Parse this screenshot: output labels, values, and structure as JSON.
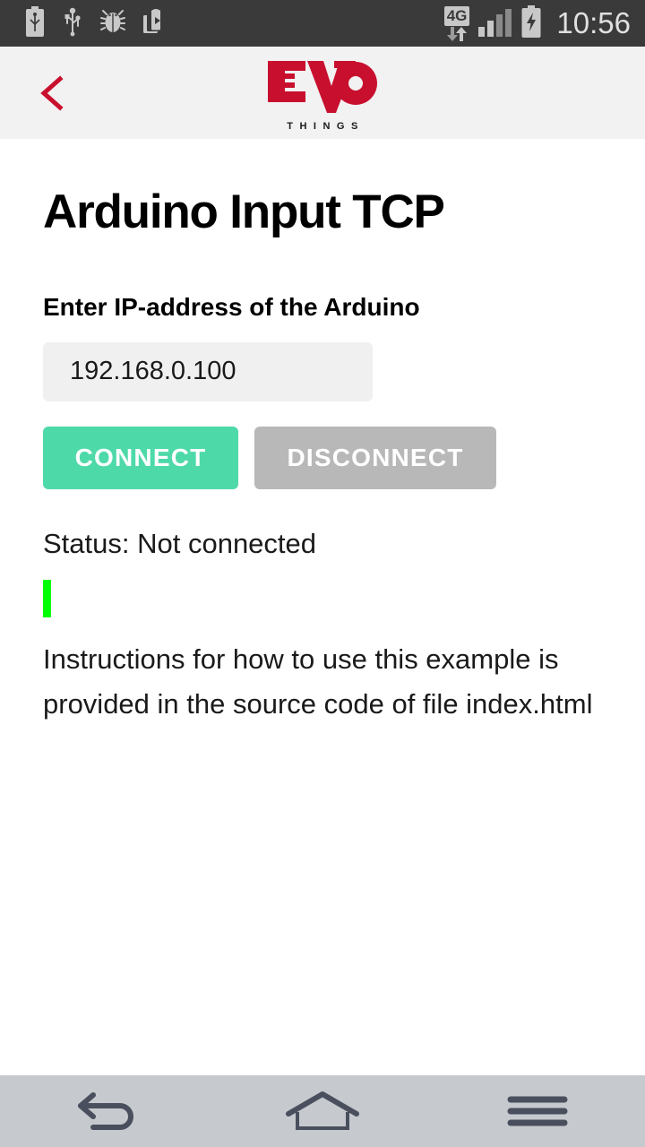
{
  "statusbar": {
    "icons_left": [
      "usb-battery-icon",
      "usb-icon",
      "debug-bug-icon",
      "play-store-icon"
    ],
    "network_type": "4G",
    "network_arrows": "down-up-arrows-icon",
    "signal_icon": "signal-bars-icon",
    "signal_bars_active": 4,
    "battery_icon": "battery-charging-icon",
    "clock": "10:56"
  },
  "appbar": {
    "back_icon": "back-chevron-icon",
    "back_glyph": "<",
    "logo_main": "EVO",
    "logo_sub": "THINGS",
    "logo_color": "#c8102e",
    "background": "#f2f2f2"
  },
  "main": {
    "title": "Arduino Input TCP",
    "field_label": "Enter IP-address of the Arduino",
    "ip_value": "192.168.0.100",
    "ip_placeholder": "192.168.0.100",
    "connect_label": "CONNECT",
    "disconnect_label": "DISCONNECT",
    "connect_color": "#4ed9a9",
    "disconnect_color": "#b8b8b8",
    "status_text": "Status: Not connected",
    "indicator_color": "#00ff00",
    "instructions": "Instructions for how to use this example is provided in the source code of file index.html"
  },
  "navbar": {
    "back": "nav-back-icon",
    "home": "nav-home-icon",
    "menu": "nav-menu-icon",
    "background": "#c6cace"
  }
}
